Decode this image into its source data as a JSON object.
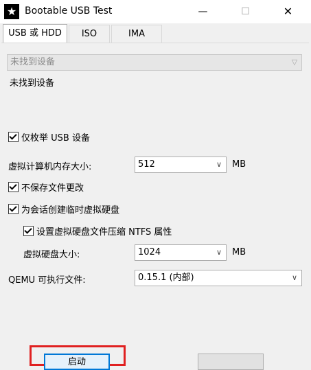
{
  "window": {
    "title": "Bootable USB Test",
    "icon": "star-icon",
    "minimize_glyph": "—",
    "maximize_glyph": "☐",
    "close_glyph": "✕"
  },
  "tabs": [
    {
      "label": "USB 或 HDD",
      "active": true
    },
    {
      "label": "ISO",
      "active": false
    },
    {
      "label": "IMA",
      "active": false
    }
  ],
  "device": {
    "dropdown_value": "未找到设备",
    "status_text": "未找到设备"
  },
  "options": {
    "usb_only_label": "仅枚举 USB 设备",
    "usb_only_checked": true,
    "memory_label": "虚拟计算机内存大小:",
    "memory_value": "512",
    "memory_unit": "MB",
    "no_save_label": "不保存文件更改",
    "no_save_checked": true,
    "temp_disk_label": "为会话创建临时虚拟硬盘",
    "temp_disk_checked": true,
    "ntfs_label": "设置虚拟硬盘文件压缩 NTFS 属性",
    "ntfs_checked": true,
    "disk_size_label": "虚拟硬盘大小:",
    "disk_size_value": "1024",
    "disk_size_unit": "MB",
    "qemu_label": "QEMU 可执行文件:",
    "qemu_value": "0.15.1 (内部)"
  },
  "footer": {
    "start_button": "启动"
  },
  "colors": {
    "highlight": "#e02020",
    "accent": "#0078d7"
  }
}
